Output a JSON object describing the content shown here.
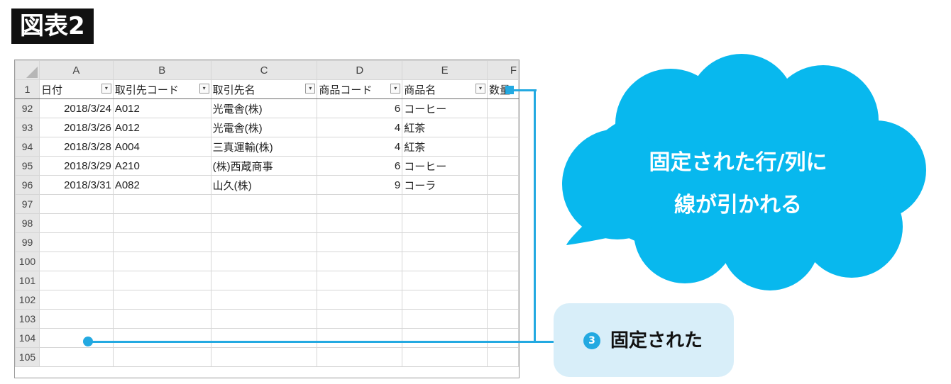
{
  "figure_label": "図表2",
  "sheet": {
    "columns": [
      "A",
      "B",
      "C",
      "D",
      "E",
      "F"
    ],
    "header_row_number": "1",
    "headers": [
      "日付",
      "取引先コード",
      "取引先名",
      "商品コード",
      "商品名",
      "数量"
    ],
    "filter_glyph": "▾",
    "rows": [
      {
        "n": "92",
        "cells": [
          "2018/3/24",
          "A012",
          "光電舎(株)",
          "6",
          "コーヒー",
          ""
        ]
      },
      {
        "n": "93",
        "cells": [
          "2018/3/26",
          "A012",
          "光電舎(株)",
          "4",
          "紅茶",
          ""
        ]
      },
      {
        "n": "94",
        "cells": [
          "2018/3/28",
          "A004",
          "三真運輸(株)",
          "4",
          "紅茶",
          ""
        ]
      },
      {
        "n": "95",
        "cells": [
          "2018/3/29",
          "A210",
          "(株)西蔵商事",
          "6",
          "コーヒー",
          ""
        ]
      },
      {
        "n": "96",
        "cells": [
          "2018/3/31",
          "A082",
          "山久(株)",
          "9",
          "コーラ",
          ""
        ]
      },
      {
        "n": "97",
        "cells": [
          "",
          "",
          "",
          "",
          "",
          ""
        ]
      },
      {
        "n": "98",
        "cells": [
          "",
          "",
          "",
          "",
          "",
          ""
        ]
      },
      {
        "n": "99",
        "cells": [
          "",
          "",
          "",
          "",
          "",
          ""
        ]
      },
      {
        "n": "100",
        "cells": [
          "",
          "",
          "",
          "",
          "",
          ""
        ]
      },
      {
        "n": "101",
        "cells": [
          "",
          "",
          "",
          "",
          "",
          ""
        ]
      },
      {
        "n": "102",
        "cells": [
          "",
          "",
          "",
          "",
          "",
          ""
        ]
      },
      {
        "n": "103",
        "cells": [
          "",
          "",
          "",
          "",
          "",
          ""
        ]
      },
      {
        "n": "104",
        "cells": [
          "",
          "",
          "",
          "",
          "",
          ""
        ]
      },
      {
        "n": "105",
        "cells": [
          "",
          "",
          "",
          "",
          "",
          ""
        ]
      }
    ]
  },
  "callout": {
    "line1": "固定された行/列に",
    "line2": "線が引かれる"
  },
  "step": {
    "number": "3",
    "label": "固定された"
  },
  "colors": {
    "accent": "#23a9e1",
    "cloud": "#08b8ee",
    "step_bg": "#d8eef9"
  }
}
